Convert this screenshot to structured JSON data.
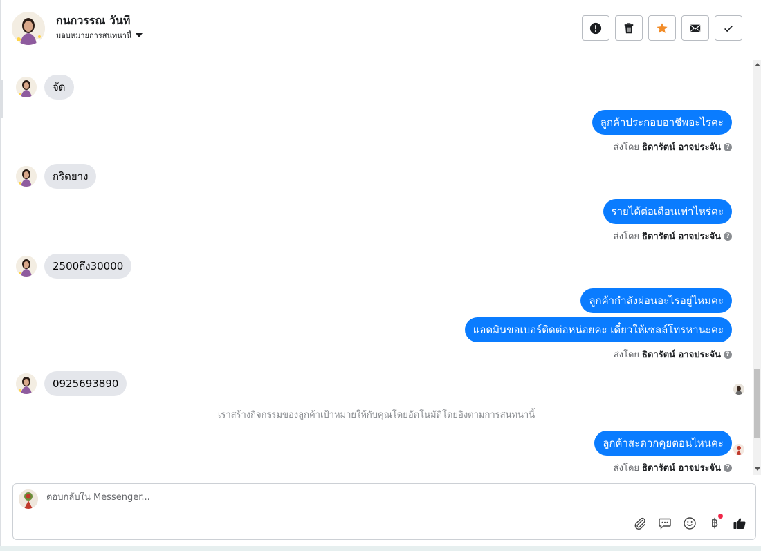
{
  "header": {
    "contact_name": "กนกวรรณ วันที",
    "assign_label": "มอบหมายการสนทนานี้",
    "actions": [
      {
        "name": "spam-button",
        "icon": "alert-icon"
      },
      {
        "name": "delete-button",
        "icon": "trash-icon"
      },
      {
        "name": "star-button",
        "icon": "star-icon",
        "color": "#f28c28"
      },
      {
        "name": "mark-unread-button",
        "icon": "envelope-icon"
      },
      {
        "name": "mark-done-button",
        "icon": "check-icon"
      }
    ]
  },
  "messages": {
    "m1": "จัด",
    "m2": "ลูกค้าประกอบอาชีพอะไรคะ",
    "m3": "กริดยาง",
    "m4": "รายได้ต่อเดือนเท่าไหร่คะ",
    "m5": "2500ถึง30000",
    "m6": "ลูกค้ากำลังผ่อนอะไรอยู่ไหมคะ",
    "m7": "แอดมินขอเบอร์ติดต่อหน่อยคะ เดี๋ยวให้เซลล์โทรหานะคะ",
    "m8": "0925693890",
    "m9": "ลูกค้าสะดวกคุยตอนไหนคะ"
  },
  "sent_by": {
    "prefix": "ส่งโดย",
    "agent": "ธิดารัตน์ อาจประจัน",
    "help": "?"
  },
  "system_note": "เราสร้างกิจกรรมของลูกค้าเป้าหมายให้กับคุณโดยอัตโนมัติโดยอิงตามการสนทนานี้",
  "composer": {
    "placeholder": "ตอบกลับใน Messenger...",
    "value": "",
    "currency_symbol": "฿",
    "tools": [
      "paperclip-icon",
      "chat-bubble-icon",
      "smiley-icon",
      "baht-icon",
      "thumbs-up-icon"
    ]
  },
  "colors": {
    "outgoing_bubble": "#0a7cff",
    "incoming_bubble": "#e4e6eb",
    "star": "#f28c28",
    "notification_dot": "#f02849"
  }
}
